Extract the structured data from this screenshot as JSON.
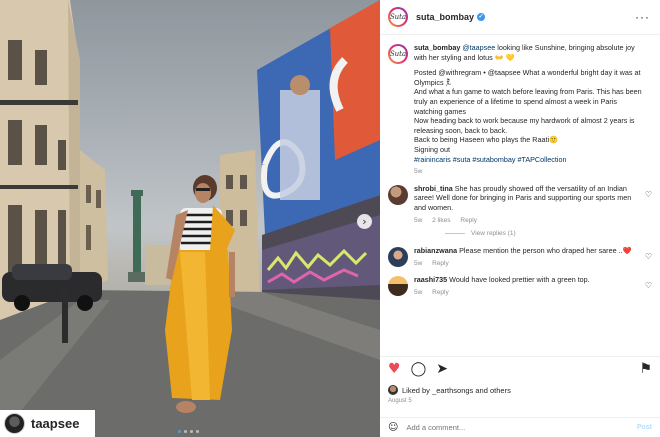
{
  "photo": {
    "tagged_user": "taapsee",
    "carousel": {
      "count": 4,
      "active": 0
    }
  },
  "header": {
    "username": "suta_bombay",
    "verified_icon": "verified-badge-icon",
    "avatar_text": "Suta"
  },
  "caption": {
    "username": "suta_bombay",
    "mention": "@taapsee",
    "text": "looking like Sunshine, bringing absolute joy with her styling and lotus",
    "emojis": "👐 💛",
    "body_lines": [
      "Posted @withregram • @taapsee What a wonderful bright day it was at Olympics🏃🏻‍♀️",
      "And what a fun game to watch before leaving from Paris. This has been truly an experience of a lifetime to spend almost a week in Paris watching games",
      "Now heading back to work because my hardwork of almost 2 years is releasing soon, back to back.",
      "Back to being Haseen who plays the Raati🙂",
      "Signing out",
      "#rainincaris #suta #sutabombay #TAPCollection"
    ],
    "time": "5w"
  },
  "comments": [
    {
      "username": "shrobi_tina",
      "text": "She has proudly showed off the versatility of an Indian saree! Well done for bringing in Paris and supporting our sports men and women.",
      "time": "5w",
      "likes": "2 likes",
      "reply": "Reply",
      "view_replies": "View replies (1)"
    },
    {
      "username": "rabianzwana",
      "text": "Please mention the person who draped her saree ..❤️",
      "time": "5w",
      "reply": "Reply"
    },
    {
      "username": "raashi735",
      "text": "Would have looked prettier with a green top.",
      "time": "5w",
      "reply": "Reply"
    }
  ],
  "actions": {
    "like_icon": "heart-filled-icon",
    "comment_icon": "comment-icon",
    "share_icon": "share-icon",
    "save_icon": "bookmark-icon",
    "likes_text": "Liked by _earthsongs and others",
    "date": "August 5"
  },
  "add_comment": {
    "placeholder": "Add a comment...",
    "post_label": "Post"
  },
  "colors": {
    "accent_link": "#00376b",
    "like_red": "#ed4956",
    "saree_yellow": "#e8a21c",
    "billboard_blue": "#3c68b4"
  }
}
